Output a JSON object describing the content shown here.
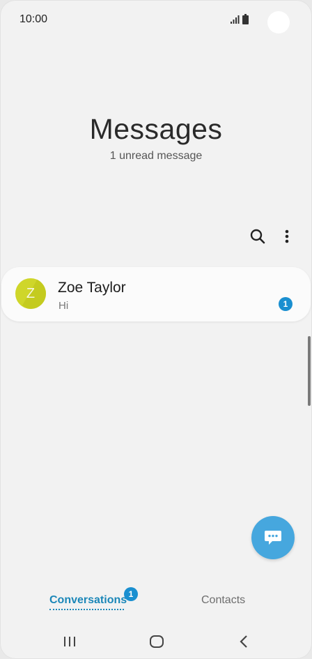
{
  "status_bar": {
    "time": "10:00",
    "icons": [
      "signal-icon",
      "battery-icon"
    ]
  },
  "header": {
    "title": "Messages",
    "subtitle": "1 unread message"
  },
  "toolbar": {
    "icons": [
      "search-icon",
      "more-options-icon"
    ]
  },
  "conversations": [
    {
      "avatar_letter": "Z",
      "name": "Zoe Taylor",
      "preview": "Hi",
      "unread_count": "1",
      "avatar_color": "#cfd62a"
    }
  ],
  "fab": {
    "icon": "compose-message-icon",
    "color": "#46a7de"
  },
  "tabs": [
    {
      "label": "Conversations",
      "badge": "1",
      "active": true
    },
    {
      "label": "Contacts",
      "active": false
    }
  ],
  "nav_bar": {
    "icons": [
      "recent-apps-icon",
      "home-icon",
      "back-icon"
    ]
  },
  "colors": {
    "accent": "#1b87b8",
    "badge": "#1a8fd0",
    "background": "#f2f2f2"
  }
}
